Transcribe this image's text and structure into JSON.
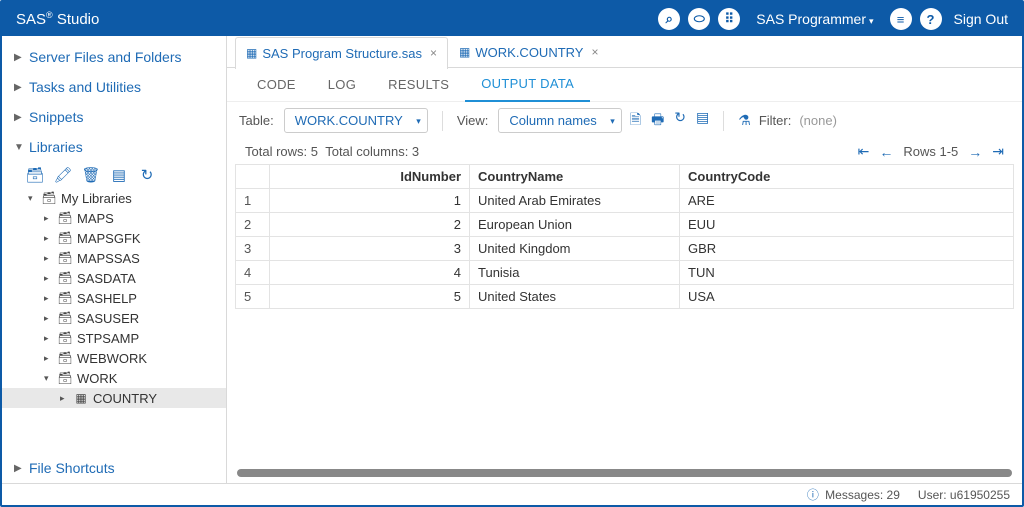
{
  "header": {
    "title_prefix": "SAS",
    "title_suffix": "Studio",
    "user_label": "SAS Programmer",
    "signout_label": "Sign Out"
  },
  "nav_sections": {
    "files": "Server Files and Folders",
    "tasks": "Tasks and Utilities",
    "snippets": "Snippets",
    "libraries": "Libraries",
    "shortcuts": "File Shortcuts"
  },
  "tree": {
    "root": "My Libraries",
    "items": [
      "MAPS",
      "MAPSGFK",
      "MAPSSAS",
      "SASDATA",
      "SASHELP",
      "SASUSER",
      "STPSAMP",
      "WEBWORK"
    ],
    "work": {
      "label": "WORK",
      "child": "COUNTRY"
    }
  },
  "doctabs": {
    "prog": "SAS Program Structure.sas",
    "country": "WORK.COUNTRY"
  },
  "subtabs": {
    "code": "CODE",
    "log": "LOG",
    "results": "RESULTS",
    "output": "OUTPUT DATA"
  },
  "toolbar": {
    "table_label": "Table:",
    "table_value": "WORK.COUNTRY",
    "view_label": "View:",
    "view_value": "Column names",
    "filter_label": "Filter:",
    "filter_value": "(none)"
  },
  "datainfo": {
    "total_rows": "Total rows: 5",
    "total_cols": "Total columns: 3",
    "range": "Rows 1-5"
  },
  "columns": {
    "id": "IdNumber",
    "name": "CountryName",
    "code": "CountryCode"
  },
  "rows": [
    {
      "n": "1",
      "id": "1",
      "name": "United Arab Emirates",
      "code": "ARE"
    },
    {
      "n": "2",
      "id": "2",
      "name": "European Union",
      "code": "EUU"
    },
    {
      "n": "3",
      "id": "3",
      "name": "United Kingdom",
      "code": "GBR"
    },
    {
      "n": "4",
      "id": "4",
      "name": "Tunisia",
      "code": "TUN"
    },
    {
      "n": "5",
      "id": "5",
      "name": "United States",
      "code": "USA"
    }
  ],
  "status": {
    "messages_label": "Messages:",
    "messages_count": "29",
    "user_label": "User:",
    "user_value": "u61950255"
  }
}
